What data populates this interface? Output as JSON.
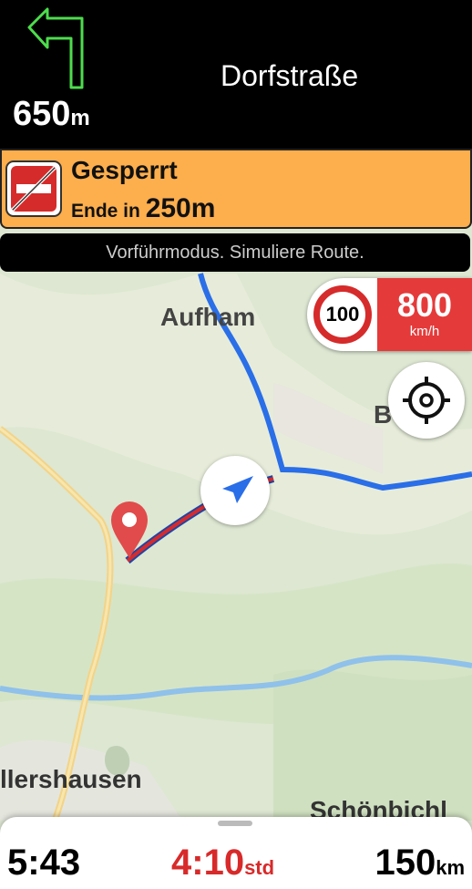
{
  "navigation": {
    "distance_value": "650",
    "distance_unit": "m",
    "street": "Dorfstraße",
    "turn_icon": "turn-left-arrow-icon"
  },
  "warning": {
    "title": "Gesperrt",
    "prefix": "Ende in ",
    "distance_value": "250",
    "distance_unit": "m",
    "icon": "road-closed-sign-icon"
  },
  "demo_banner": "Vorführmodus. Simuliere Route.",
  "speed": {
    "limit": "100",
    "current": "800",
    "unit": "km/h"
  },
  "map_labels": {
    "aufham": "Aufham",
    "b_partial": "B",
    "allershausen": "llershausen",
    "schoenbichl": "Schönbichl"
  },
  "bottom": {
    "arrival_time": "5:43",
    "duration_value": "4:10",
    "duration_unit": "std",
    "distance_value": "150",
    "distance_unit": "km"
  },
  "colors": {
    "warning_bg": "#fdae4d",
    "route": "#2a6ee8",
    "speed_red": "#e53a3a",
    "duration_red": "#d82a2a"
  }
}
